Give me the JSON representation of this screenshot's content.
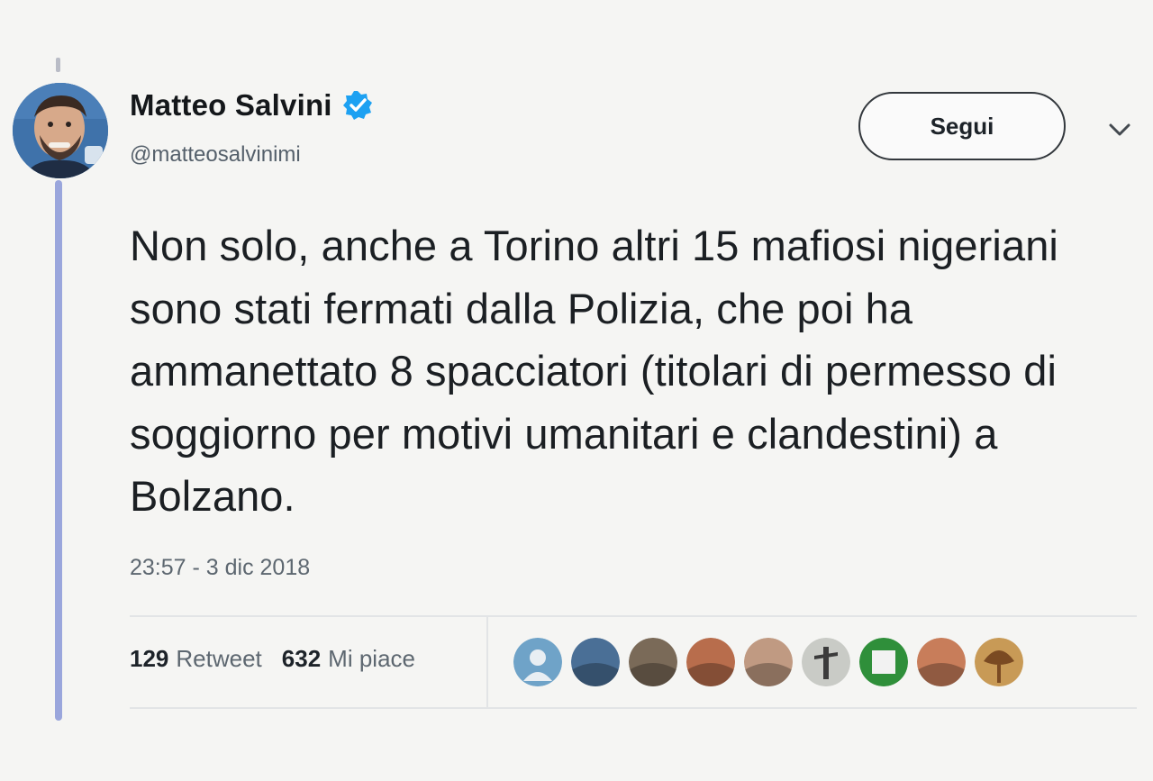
{
  "tweet": {
    "author": {
      "display_name": "Matteo Salvini",
      "handle": "@matteosalvinimi",
      "verified": true,
      "avatar_icon": "profile-photo"
    },
    "follow_label": "Segui",
    "text": "Non solo, anche a Torino altri 15 mafiosi nigeriani sono stati fermati dalla Polizia, che poi ha ammanettato 8 spacciatori (titolari di permesso di soggiorno per motivi umanitari e clandestini) a Bolzano.",
    "timestamp": "23:57 - 3 dic 2018",
    "stats": {
      "retweets_count": "129",
      "retweets_label": "Retweet",
      "likes_count": "632",
      "likes_label": "Mi piace"
    },
    "liker_avatars": [
      {
        "icon": "default-avatar",
        "color": "#6fa3c8"
      },
      {
        "icon": "city-photo-avatar",
        "color": "#4a6f96"
      },
      {
        "icon": "landscape-avatar",
        "color": "#7a6a58"
      },
      {
        "icon": "portrait-avatar",
        "color": "#b86d4c"
      },
      {
        "icon": "portrait-avatar",
        "color": "#c09a82"
      },
      {
        "icon": "figure-avatar",
        "color": "#c9cbc6"
      },
      {
        "icon": "logo-avatar",
        "color": "#2f8f3a"
      },
      {
        "icon": "portrait-avatar",
        "color": "#c87d5a"
      },
      {
        "icon": "tree-avatar",
        "color": "#c89a56"
      }
    ]
  },
  "colors": {
    "verified_badge": "#1da1f2",
    "thread_line": "#9aa6dc",
    "secondary_text": "#5d6770"
  }
}
